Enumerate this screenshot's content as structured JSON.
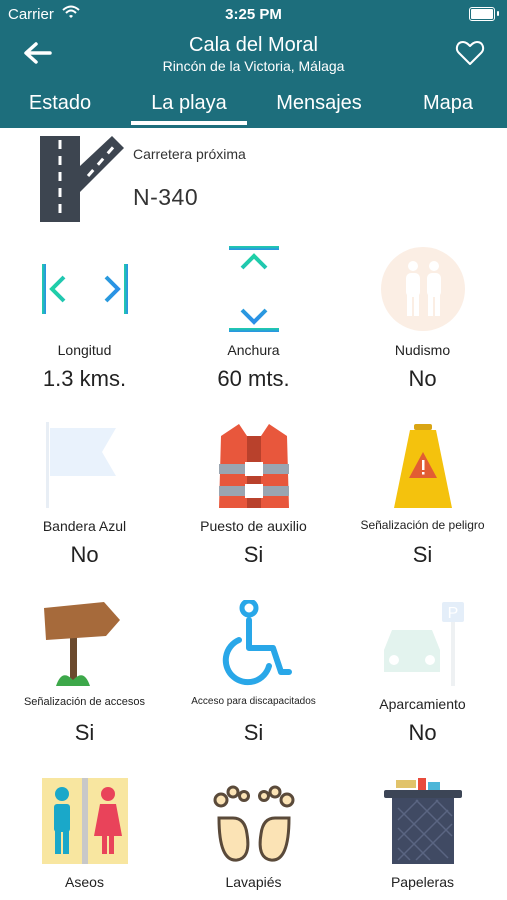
{
  "status_bar": {
    "carrier": "Carrier",
    "time": "3:25 PM"
  },
  "header": {
    "title": "Cala del Moral",
    "subtitle": "Rincón de la Victoria, Málaga"
  },
  "tabs": [
    {
      "label": "Estado"
    },
    {
      "label": "La playa",
      "active": true
    },
    {
      "label": "Mensajes"
    },
    {
      "label": "Mapa"
    }
  ],
  "road": {
    "label": "Carretera próxima",
    "value": "N-340"
  },
  "features": [
    {
      "label": "Longitud",
      "value": "1.3 kms.",
      "icon": "width-arrows-icon"
    },
    {
      "label": "Anchura",
      "value": "60 mts.",
      "icon": "height-arrows-icon"
    },
    {
      "label": "Nudismo",
      "value": "No",
      "icon": "nudism-icon"
    },
    {
      "label": "Bandera Azul",
      "value": "No",
      "icon": "blue-flag-icon"
    },
    {
      "label": "Puesto de auxilio",
      "value": "Si",
      "icon": "life-vest-icon"
    },
    {
      "label": "Señalización de peligro",
      "value": "Si",
      "icon": "warning-sign-icon"
    },
    {
      "label": "Señalización de accesos",
      "value": "Si",
      "icon": "signpost-icon"
    },
    {
      "label": "Acceso para discapacitados",
      "value": "Si",
      "icon": "wheelchair-icon"
    },
    {
      "label": "Aparcamiento",
      "value": "No",
      "icon": "parking-icon"
    },
    {
      "label": "Aseos",
      "value": "",
      "icon": "toilets-icon"
    },
    {
      "label": "Lavapiés",
      "value": "",
      "icon": "foot-wash-icon"
    },
    {
      "label": "Papeleras",
      "value": "",
      "icon": "trash-bin-icon"
    }
  ],
  "colors": {
    "header_bg": "#1d6e7c",
    "accent_teal": "#22c1b8",
    "accent_blue": "#2aa0e6"
  }
}
